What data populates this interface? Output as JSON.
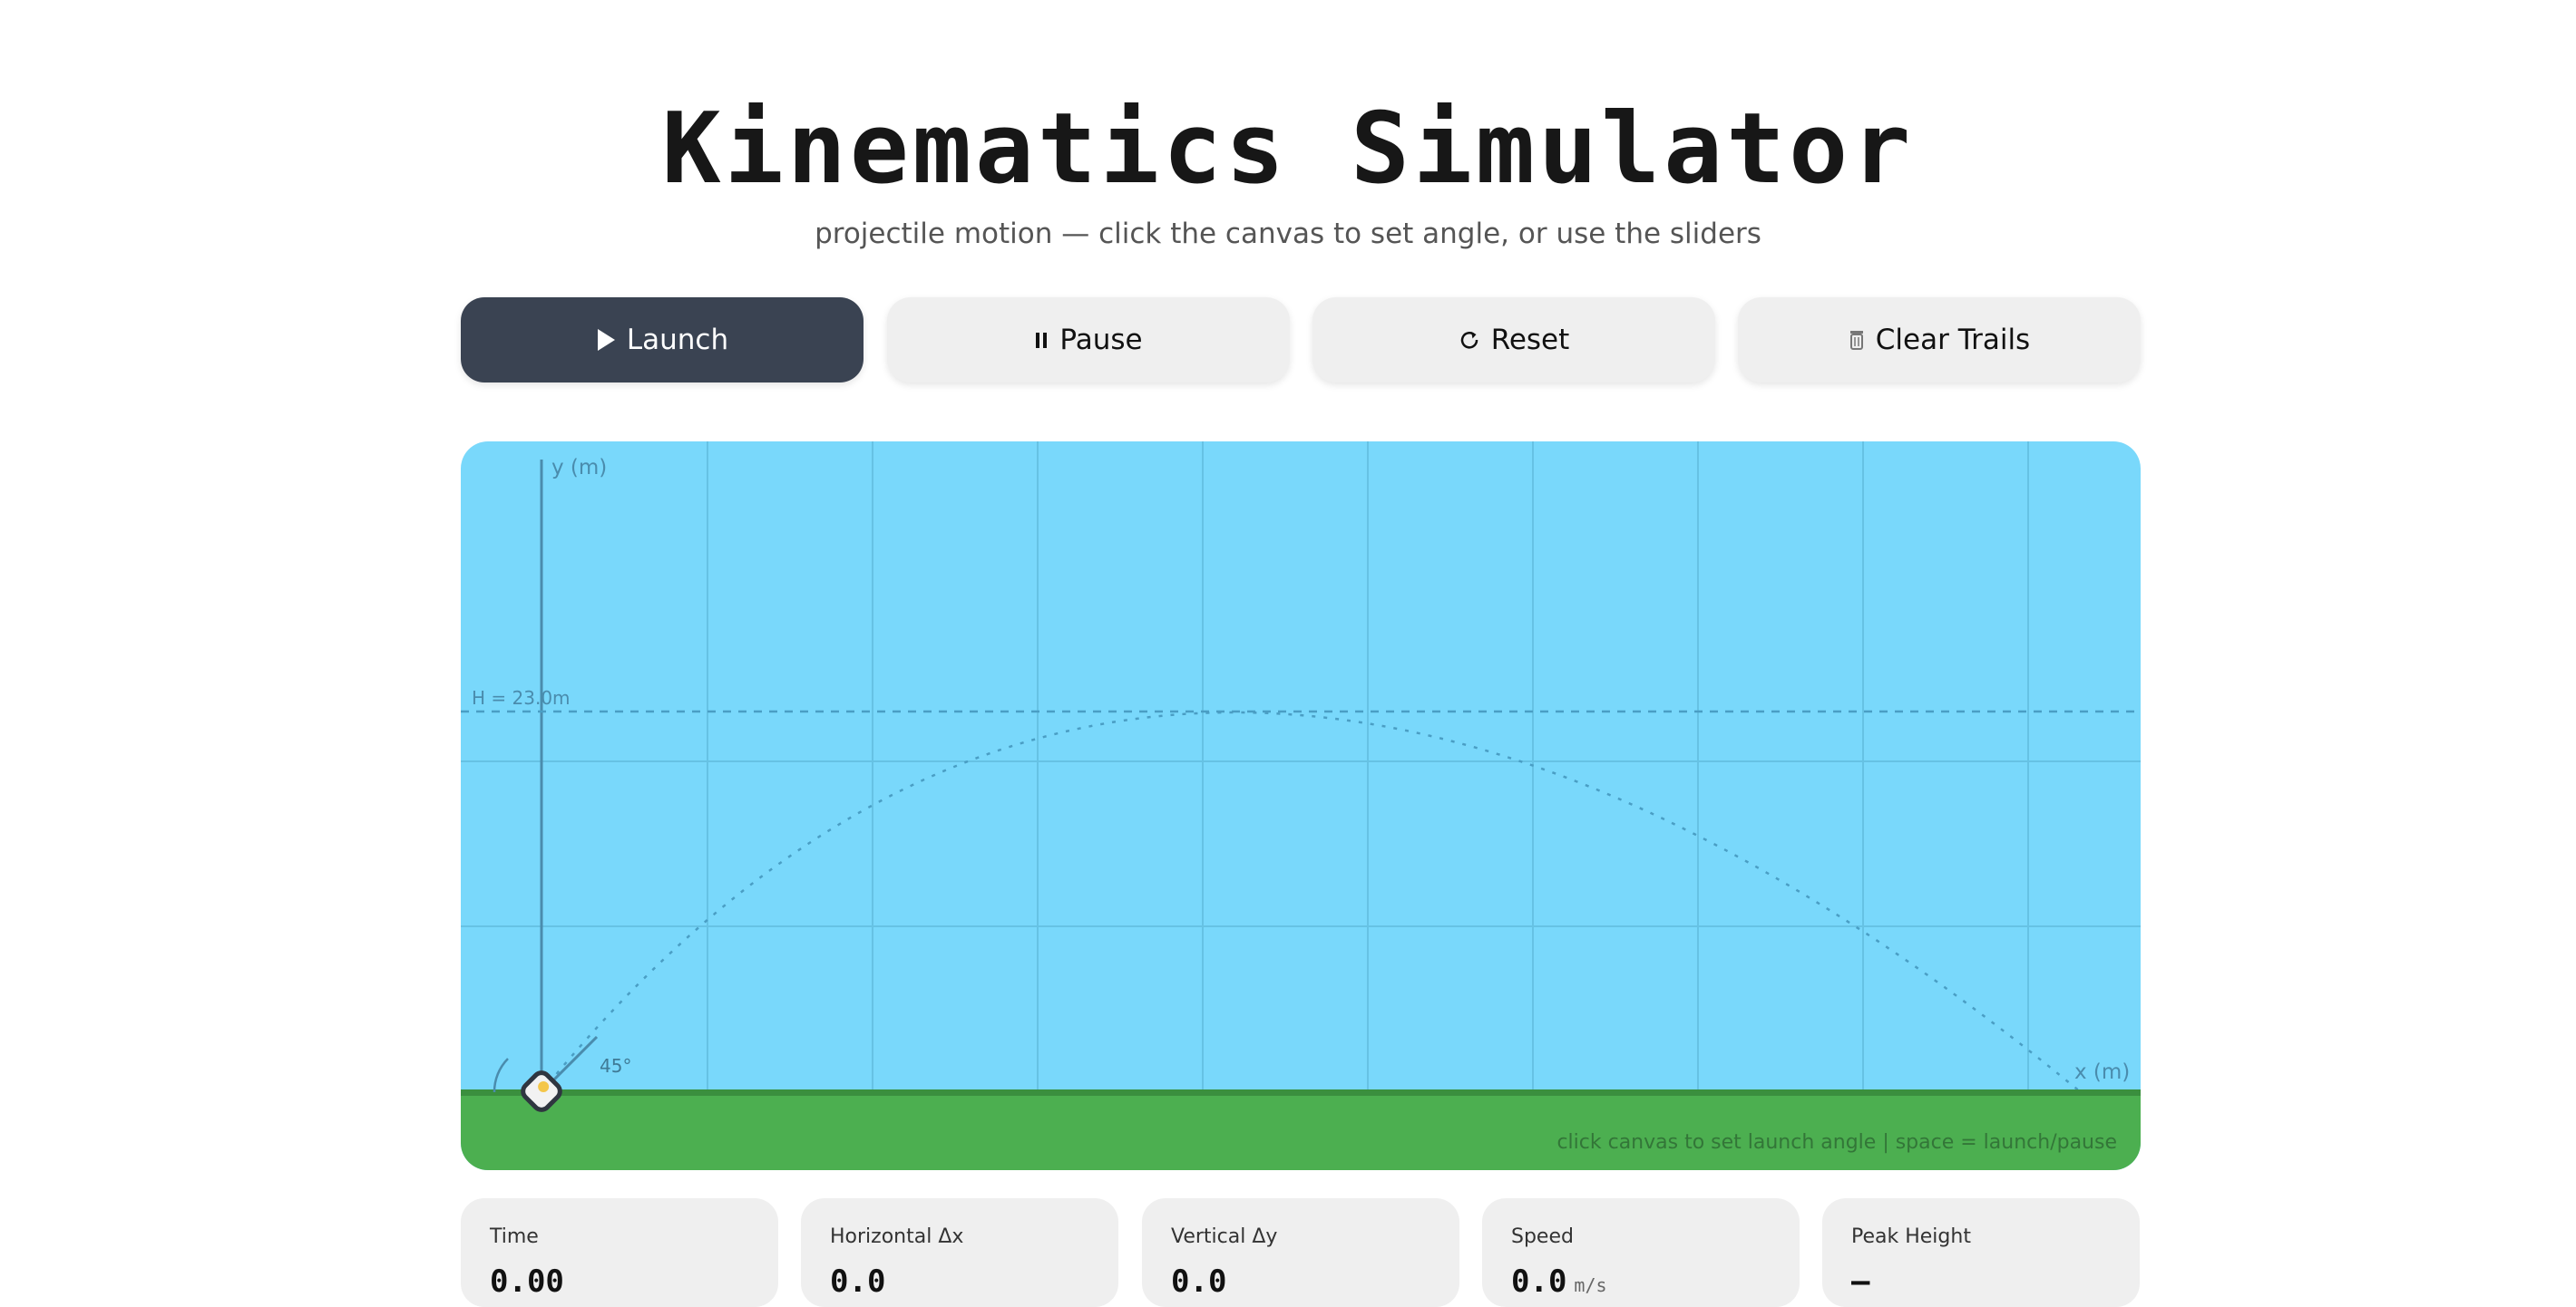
{
  "header": {
    "title": "Kinematics Simulator",
    "subtitle": "projectile motion — click the canvas to set angle, or use the sliders"
  },
  "toolbar": {
    "buttons": [
      {
        "label": "Launch",
        "icon": "play-icon"
      },
      {
        "label": "Pause",
        "icon": "pause-icon"
      },
      {
        "label": "Reset",
        "icon": "reset-icon"
      },
      {
        "label": "Clear Trails",
        "icon": "trash-icon"
      }
    ]
  },
  "canvas": {
    "y_axis_label": "y (m)",
    "x_axis_label": "x (m)",
    "peak_label": "H = 23.0m",
    "angle_label": "45°",
    "hint": "click canvas to set launch angle  |  space = launch/pause",
    "colors": {
      "sky": "#79d8fb",
      "ground": "#4caf50",
      "ground_edge": "#3a8f3e"
    }
  },
  "stats": [
    {
      "label": "Time",
      "value": "0.00",
      "unit": ""
    },
    {
      "label": "Horizontal Δx",
      "value": "0.0",
      "unit": ""
    },
    {
      "label": "Vertical Δy",
      "value": "0.0",
      "unit": ""
    },
    {
      "label": "Speed",
      "value": "0.0",
      "unit": "m/s"
    },
    {
      "label": "Peak Height",
      "value": "—",
      "unit": ""
    }
  ]
}
